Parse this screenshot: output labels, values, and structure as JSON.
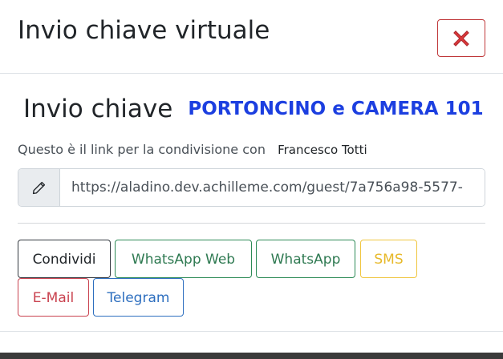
{
  "modal": {
    "title": "Invio chiave virtuale",
    "close_icon": "close-x-icon",
    "close_color": "#c0393b"
  },
  "heading": {
    "main": "Invio chiave",
    "sub": "PORTONCINO e CAMERA 101",
    "sub_color": "#1c3fe0"
  },
  "share": {
    "text": "Questo è il link per la condivisione con",
    "recipient": "Francesco Totti"
  },
  "link_field": {
    "icon": "pencil-icon",
    "value": "https://aladino.dev.achilleme.com/guest/7a756a98-5577-"
  },
  "buttons": {
    "condividi": "Condividi",
    "whatsapp_web": "WhatsApp Web",
    "whatsapp": "WhatsApp",
    "sms": "SMS",
    "email": "E-Mail",
    "telegram": "Telegram"
  }
}
